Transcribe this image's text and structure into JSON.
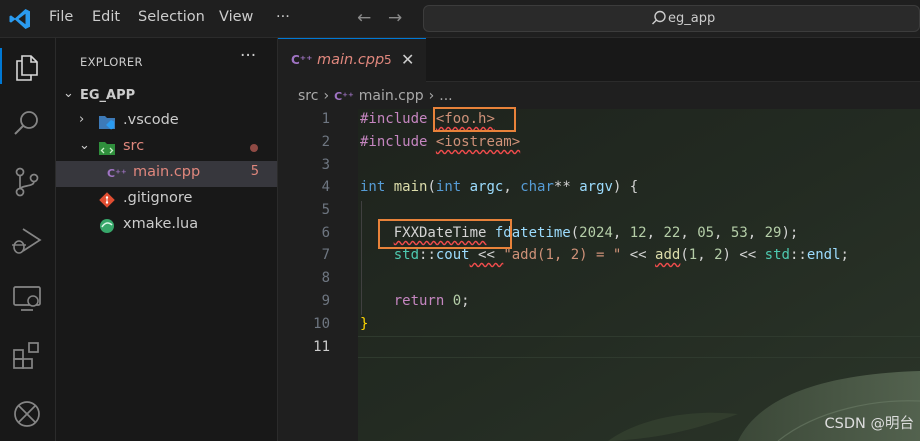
{
  "titlebar": {
    "menus": [
      "File",
      "Edit",
      "Selection",
      "View",
      "···"
    ],
    "search_text": "eg_app"
  },
  "activity_icons": [
    "explorer-icon",
    "search-icon",
    "source-control-icon",
    "run-debug-icon",
    "remote-explorer-icon",
    "extensions-icon",
    "xmake-icon"
  ],
  "explorer": {
    "title": "EXPLORER",
    "more": "···",
    "root": "EG_APP",
    "items": [
      {
        "label": ".vscode",
        "type": "folder"
      },
      {
        "label": "src",
        "type": "folder"
      },
      {
        "label": "main.cpp",
        "badge": "5"
      },
      {
        "label": ".gitignore"
      },
      {
        "label": "xmake.lua"
      }
    ]
  },
  "tab": {
    "icon": "C++",
    "name": "main.cpp",
    "count": "5",
    "close": "✕"
  },
  "breadcrumb": {
    "folder": "src",
    "sep": "›",
    "icon": "C++",
    "file": "main.cpp",
    "ellipsis": "..."
  },
  "code": {
    "line_numbers": [
      "1",
      "2",
      "3",
      "4",
      "5",
      "6",
      "7",
      "8",
      "9",
      "10",
      "11"
    ],
    "l1": {
      "kw": "#include",
      "path": "<foo.h>"
    },
    "l2": {
      "kw": "#include",
      "path": "<iostream>"
    },
    "l4": {
      "t1": "int",
      "fn": "main",
      "p1": "(",
      "t2": "int",
      "v1": "argc",
      "c1": ", ",
      "t3": "char",
      "s1": "**",
      "v2": "argv",
      "p2": ") {"
    },
    "l6": {
      "ty": "FXXDateTime",
      "var": "fdatetime",
      "p1": "(",
      "n1": "2024",
      "c1": ", ",
      "n2": "12",
      "c2": ", ",
      "n3": "22",
      "c3": ", ",
      "n4": "05",
      "c4": ", ",
      "n5": "53",
      "c5": ", ",
      "n6": "29",
      "p2": ");"
    },
    "l7": {
      "ns1": "std",
      "sc1": "::",
      "v1": "cout",
      "op1": " << ",
      "str": "\"add(1, 2) = \"",
      "op2": " << ",
      "fn": "add",
      "p1": "(",
      "n1": "1",
      "c1": ", ",
      "n2": "2",
      "p2": ")",
      "op3": " << ",
      "ns2": "std",
      "sc2": "::",
      "v2": "endl",
      "p3": ";"
    },
    "l9": {
      "kw": "return",
      "sp": " ",
      "num": "0",
      "p": ";"
    },
    "l10": {
      "brace": "}"
    }
  },
  "watermark": "CSDN @明台"
}
